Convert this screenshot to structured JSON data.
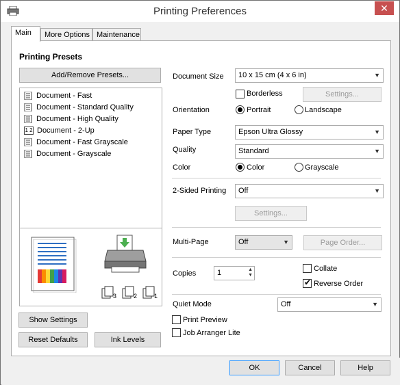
{
  "window": {
    "title": "Printing Preferences",
    "close": "✕"
  },
  "tabs": [
    "Main",
    "More Options",
    "Maintenance"
  ],
  "presets": {
    "heading": "Printing Presets",
    "add_remove": "Add/Remove Presets...",
    "items": [
      "Document - Fast",
      "Document - Standard Quality",
      "Document - High Quality",
      "Document - 2-Up",
      "Document - Fast Grayscale",
      "Document - Grayscale"
    ],
    "icon_2up": "1 2",
    "page_count_icons": [
      "3",
      "2",
      "1"
    ]
  },
  "left_buttons": {
    "show_settings": "Show Settings",
    "reset_defaults": "Reset Defaults",
    "ink_levels": "Ink Levels"
  },
  "form": {
    "document_size_label": "Document Size",
    "document_size_value": "10 x 15 cm (4 x 6 in)",
    "borderless_label": "Borderless",
    "borderless_settings": "Settings...",
    "orientation_label": "Orientation",
    "portrait": "Portrait",
    "landscape": "Landscape",
    "paper_type_label": "Paper Type",
    "paper_type_value": "Epson Ultra Glossy",
    "quality_label": "Quality",
    "quality_value": "Standard",
    "color_label": "Color",
    "color_opt": "Color",
    "grayscale_opt": "Grayscale",
    "two_sided_label": "2-Sided Printing",
    "two_sided_value": "Off",
    "two_sided_settings": "Settings...",
    "multipage_label": "Multi-Page",
    "multipage_value": "Off",
    "page_order": "Page Order...",
    "copies_label": "Copies",
    "copies_value": "1",
    "collate_label": "Collate",
    "reverse_order_label": "Reverse Order",
    "quiet_mode_label": "Quiet Mode",
    "quiet_mode_value": "Off",
    "print_preview_label": "Print Preview",
    "job_arranger_label": "Job Arranger Lite"
  },
  "footer": {
    "ok": "OK",
    "cancel": "Cancel",
    "help": "Help"
  },
  "colors": {
    "close_red": "#c75050",
    "accent_blue": "#3399ff",
    "printer_green": "#4caf50"
  }
}
